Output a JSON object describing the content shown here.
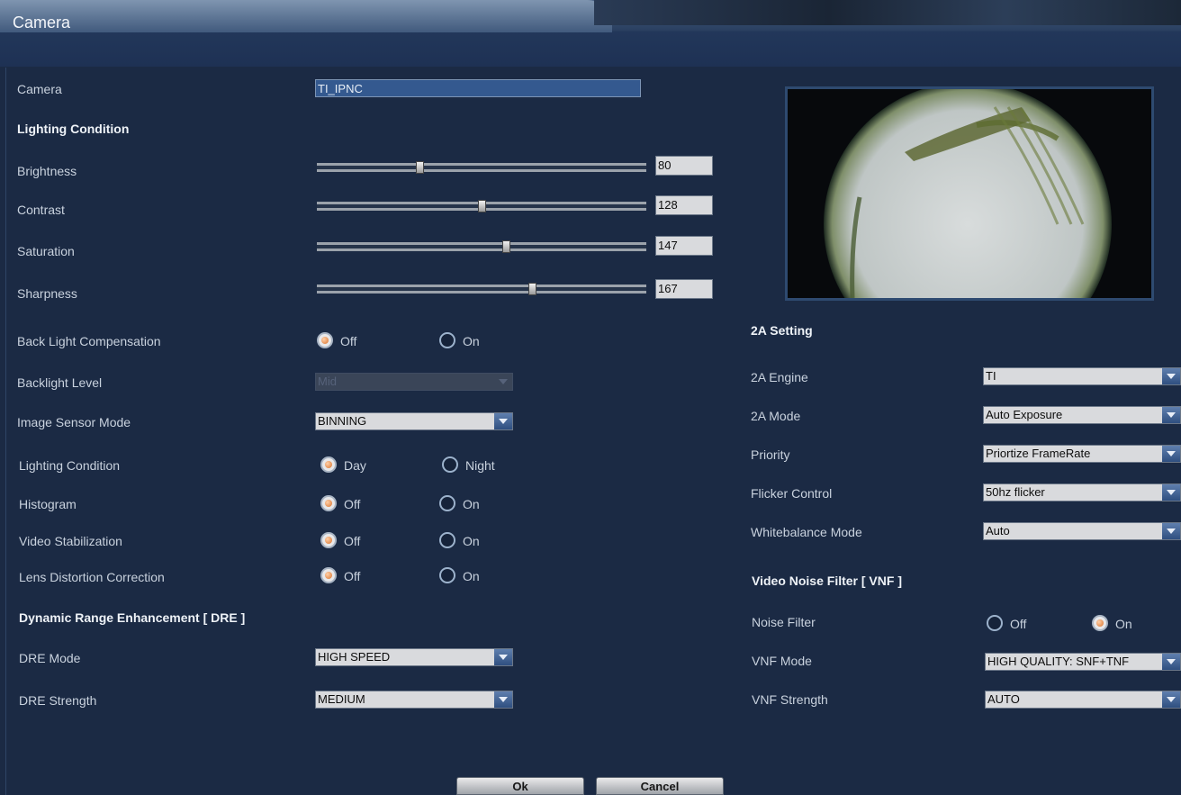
{
  "window": {
    "title": "Camera"
  },
  "left": {
    "camera_label": "Camera",
    "camera_name": "TI_IPNC",
    "lighting_header": "Lighting Condition",
    "sliders": [
      {
        "label": "Brightness",
        "value": "80",
        "max": 255
      },
      {
        "label": "Contrast",
        "value": "128",
        "max": 255
      },
      {
        "label": "Saturation",
        "value": "147",
        "max": 255
      },
      {
        "label": "Sharpness",
        "value": "167",
        "max": 255
      }
    ],
    "backlight_comp": {
      "label": "Back Light Compensation",
      "off": "Off",
      "on": "On",
      "selected": "Off"
    },
    "backlight_level": {
      "label": "Backlight Level",
      "value": "Mid"
    },
    "sensor_mode": {
      "label": "Image Sensor Mode",
      "value": "BINNING"
    },
    "lighting": {
      "label": "Lighting Condition",
      "day": "Day",
      "night": "Night",
      "selected": "Day"
    },
    "histogram": {
      "label": "Histogram",
      "off": "Off",
      "on": "On",
      "selected": "Off"
    },
    "stabilization": {
      "label": "Video Stabilization",
      "off": "Off",
      "on": "On",
      "selected": "Off"
    },
    "ldc": {
      "label": "Lens Distortion Correction",
      "off": "Off",
      "on": "On",
      "selected": "Off"
    },
    "dre_header": "Dynamic Range Enhancement [ DRE ]",
    "dre_mode": {
      "label": "DRE Mode",
      "value": "HIGH SPEED"
    },
    "dre_strength": {
      "label": "DRE Strength",
      "value": "MEDIUM"
    }
  },
  "right": {
    "twoa_header": "2A Setting",
    "engine": {
      "label": "2A Engine",
      "value": "TI"
    },
    "mode": {
      "label": "2A Mode",
      "value": "Auto Exposure"
    },
    "priority": {
      "label": "Priority",
      "value": "Priortize FrameRate"
    },
    "flicker": {
      "label": "Flicker Control",
      "value": "50hz flicker"
    },
    "wb": {
      "label": "Whitebalance Mode",
      "value": "Auto"
    },
    "vnf_header": "Video Noise Filter [ VNF ]",
    "noise_filter": {
      "label": "Noise Filter",
      "off": "Off",
      "on": "On",
      "selected": "On"
    },
    "vnf_mode": {
      "label": "VNF Mode",
      "value": "HIGH QUALITY: SNF+TNF"
    },
    "vnf_strength": {
      "label": "VNF Strength",
      "value": "AUTO"
    }
  },
  "buttons": {
    "ok": "Ok",
    "cancel": "Cancel"
  }
}
